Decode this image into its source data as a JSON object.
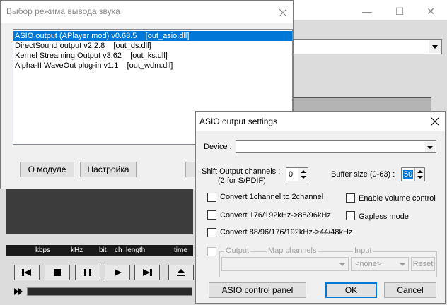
{
  "output_dialog": {
    "title": "Выбор режима вывода звука",
    "plugins": [
      "ASIO output (APlayer mod) v0.68.5    [out_asio.dll]",
      "DirectSound output v2.2.8    [out_ds.dll]",
      "Kernel Streaming Output v3.62    [out_ks.dll]",
      "Alpha-II WaveOut plug-in v1.1    [out_wdm.dll]"
    ],
    "about_label": "О модуле",
    "config_label": "Настройка"
  },
  "player": {
    "info_columns": [
      "kbps",
      "kHz",
      "bit",
      "ch",
      "length",
      "time"
    ]
  },
  "asio_dialog": {
    "title": "ASIO output settings",
    "device_label": "Device :",
    "device_value": "",
    "shift_label": "Shift Output channels :",
    "shift_sublabel": "(2 for S/PDIF)",
    "shift_value": "0",
    "buffer_label": "Buffer size (0-63) :",
    "buffer_value": "50",
    "options": {
      "convert_1ch": "Convert 1channel to 2channel",
      "convert_176": "Convert 176/192kHz->88/96kHz",
      "convert_88": "Convert 88/96/176/192kHz->44/48kHz",
      "volume_control": "Enable volume control",
      "gapless": "Gapless mode"
    },
    "map": {
      "output_label": "Output",
      "map_channels_label": "Map channels",
      "input_label": "Input",
      "input_value": "<none>",
      "reset_label": "Reset"
    },
    "panel_label": "ASIO control panel",
    "ok_label": "OK",
    "cancel_label": "Cancel"
  },
  "colors": {
    "selection": "#0078d7",
    "default_border": "#0078d7"
  }
}
